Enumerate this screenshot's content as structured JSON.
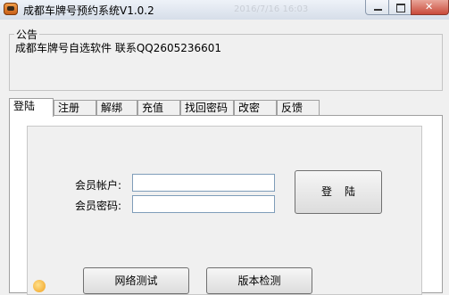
{
  "window": {
    "title": "成都车牌号预约系统V1.0.2",
    "faded_timestamp": "2016/7/16 16:03"
  },
  "notice": {
    "legend": "公告",
    "text": "成都车牌号自选软件 联系QQ2605236601"
  },
  "tabs": [
    {
      "label": "登陆",
      "active": true
    },
    {
      "label": "注册",
      "active": false
    },
    {
      "label": "解绑",
      "active": false
    },
    {
      "label": "充值",
      "active": false
    },
    {
      "label": "找回密码",
      "active": false
    },
    {
      "label": "改密",
      "active": false
    },
    {
      "label": "反馈",
      "active": false
    }
  ],
  "login_form": {
    "account_label": "会员帐户:",
    "account_value": "",
    "password_label": "会员密码:",
    "password_value": "",
    "login_button": "登陆"
  },
  "bottom_buttons": {
    "network_test": "网络测试",
    "version_check": "版本检测"
  },
  "icons": [
    "car-app-icon",
    "minimize-icon",
    "maximize-icon",
    "close-icon",
    "tray-icon"
  ],
  "colors": {
    "window_bg": "#f0f0f0",
    "close_button": "#c94a3a",
    "input_border": "#7f9db9"
  }
}
